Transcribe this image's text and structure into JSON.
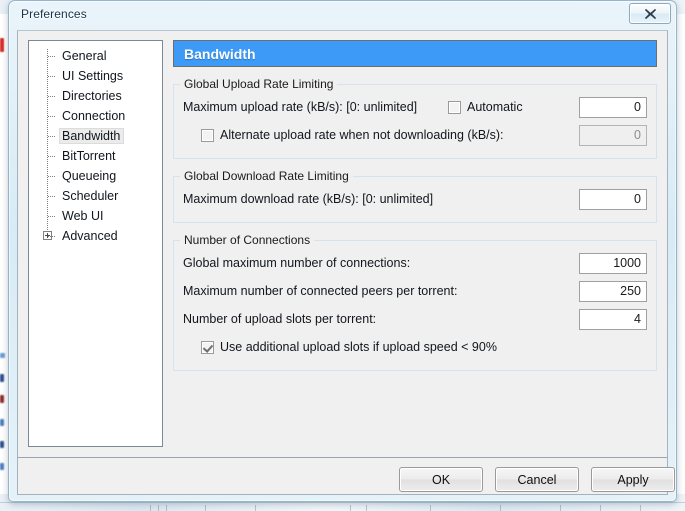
{
  "window": {
    "title": "Preferences",
    "close_icon": "close-x-icon"
  },
  "sidebar": {
    "items": [
      {
        "label": "General",
        "selected": false,
        "expandable": false
      },
      {
        "label": "UI Settings",
        "selected": false,
        "expandable": false
      },
      {
        "label": "Directories",
        "selected": false,
        "expandable": false
      },
      {
        "label": "Connection",
        "selected": false,
        "expandable": false
      },
      {
        "label": "Bandwidth",
        "selected": true,
        "expandable": false
      },
      {
        "label": "BitTorrent",
        "selected": false,
        "expandable": false
      },
      {
        "label": "Queueing",
        "selected": false,
        "expandable": false
      },
      {
        "label": "Scheduler",
        "selected": false,
        "expandable": false
      },
      {
        "label": "Web UI",
        "selected": false,
        "expandable": false
      },
      {
        "label": "Advanced",
        "selected": false,
        "expandable": true
      }
    ]
  },
  "page": {
    "header_title": "Bandwidth",
    "header_color": "#3d9bf7",
    "groups": {
      "upload": {
        "legend": "Global Upload Rate Limiting",
        "max_rate_label": "Maximum upload rate (kB/s): [0: unlimited]",
        "automatic_label": "Automatic",
        "automatic_checked": false,
        "max_rate_value": "0",
        "alternate_label": "Alternate upload rate when not downloading (kB/s):",
        "alternate_checked": false,
        "alternate_value": "0",
        "alternate_disabled": true
      },
      "download": {
        "legend": "Global Download Rate Limiting",
        "max_rate_label": "Maximum download rate (kB/s): [0: unlimited]",
        "max_rate_value": "0"
      },
      "connections": {
        "legend": "Number of Connections",
        "global_max_label": "Global maximum number of connections:",
        "global_max_value": "1000",
        "max_peers_label": "Maximum number of connected peers per torrent:",
        "max_peers_value": "250",
        "upload_slots_label": "Number of upload slots per torrent:",
        "upload_slots_value": "4",
        "additional_slots_label": "Use additional upload slots if upload speed < 90%",
        "additional_slots_checked": true
      }
    }
  },
  "buttons": {
    "ok": "OK",
    "cancel": "Cancel",
    "apply": "Apply"
  }
}
